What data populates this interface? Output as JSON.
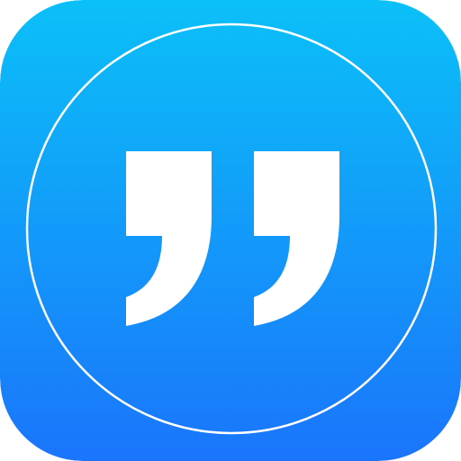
{
  "app_icon": {
    "icon_name": "quotation-marks-icon",
    "colors": {
      "gradient_top": "#0bc0f8",
      "gradient_bottom": "#1a75fb",
      "ring": "#ffffff",
      "glyph": "#ffffff"
    }
  }
}
